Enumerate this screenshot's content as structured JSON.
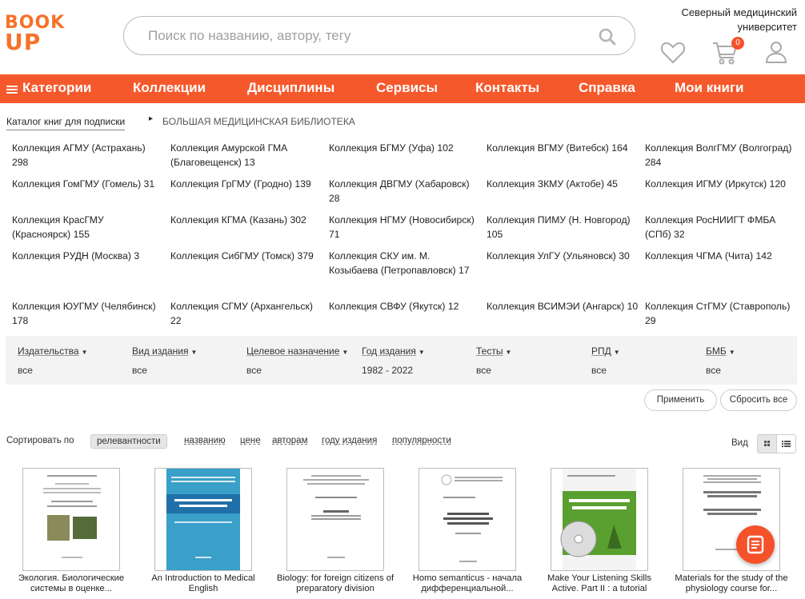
{
  "logo": {
    "line1": "BOOK",
    "line2": "UP"
  },
  "search": {
    "placeholder": "Поиск по названию, автору, тегу"
  },
  "university": "Северный медицинский университет",
  "cart": {
    "count": "0"
  },
  "nav": {
    "items": [
      "Категории",
      "Коллекции",
      "Дисциплины",
      "Сервисы",
      "Контакты",
      "Справка",
      "Мои книги"
    ]
  },
  "breadcrumb": {
    "parent": "Каталог книг для подписки",
    "current": "БОЛЬШАЯ МЕДИЦИНСКАЯ БИБЛИОТЕКА"
  },
  "collections": [
    [
      "Коллекция АГМУ (Астрахань) 298",
      "Коллекция Амурской ГМА (Благовещенск) 13",
      "Коллекция БГМУ (Уфа) 102",
      "Коллекция ВГМУ (Витебск) 164",
      "Коллекция ВолгГМУ (Волгоград) 284"
    ],
    [
      "Коллекция ГомГМУ (Гомель) 31",
      "Коллекция ГрГМУ (Гродно) 139",
      "Коллекция ДВГМУ (Хабаровск) 28",
      "Коллекция ЗКМУ (Актобе) 45",
      "Коллекция ИГМУ (Иркутск) 120"
    ],
    [
      "Коллекция КрасГМУ (Красноярск) 155",
      "Коллекция КГМА (Казань) 302",
      "Коллекция НГМУ (Новосибирск) 71",
      "Коллекция ПИМУ (Н. Новгород) 105",
      "Коллекция РосНИИГТ ФМБА (СПб) 32"
    ],
    [
      "Коллекция РУДН (Москва) 3",
      "Коллекция СибГМУ (Томск) 379",
      "Коллекция СКУ им. М. Козыбаева (Петропавловск) 17",
      "Коллекция УлГУ (Ульяновск) 30",
      "Коллекция ЧГМА (Чита) 142"
    ],
    [
      "Коллекция ЮУГМУ (Челябинск) 178",
      "Коллекция СГМУ (Архангельск) 22",
      "Коллекция СВФУ (Якутск) 12",
      "Коллекция ВСИМЭИ (Ангарск) 10",
      "Коллекция СтГМУ (Ставрополь) 29"
    ]
  ],
  "filters": [
    {
      "label": "Издательства",
      "value": "все"
    },
    {
      "label": "Вид издания",
      "value": "все"
    },
    {
      "label": "Целевое назначение",
      "value": "все"
    },
    {
      "label": "Год издания",
      "value": "1982 - 2022"
    },
    {
      "label": "Тесты",
      "value": "все"
    },
    {
      "label": "РПД",
      "value": "все"
    },
    {
      "label": "БМБ",
      "value": "все"
    }
  ],
  "buttons": {
    "apply": "Применить",
    "reset": "Сбросить все"
  },
  "sort": {
    "label": "Сортировать по",
    "active": "релевантности",
    "options": [
      "названию",
      "цене",
      "авторам",
      "году издания",
      "популярности"
    ]
  },
  "view_label": "Вид",
  "books": [
    {
      "title": "Экология. Биологические системы в оценке..."
    },
    {
      "title": "An Introduction to Medical English"
    },
    {
      "title": "Biology: for foreign citizens of preparatory division"
    },
    {
      "title": "Homo semanticus - начала дифференциальной..."
    },
    {
      "title": "Make Your Listening Skills Active. Part II : a tutorial"
    },
    {
      "title": "Materials for the study of the physiology course for..."
    }
  ],
  "colors": {
    "accent": "#f5592b",
    "filter_bg": "#f3f3f3",
    "cover_blue": "#3a9fc9",
    "cover_green": "#5aa030"
  },
  "icons": [
    "search-icon",
    "heart-icon",
    "cart-icon",
    "user-icon",
    "menu-icon",
    "grid-view-icon",
    "list-view-icon",
    "document-icon"
  ]
}
